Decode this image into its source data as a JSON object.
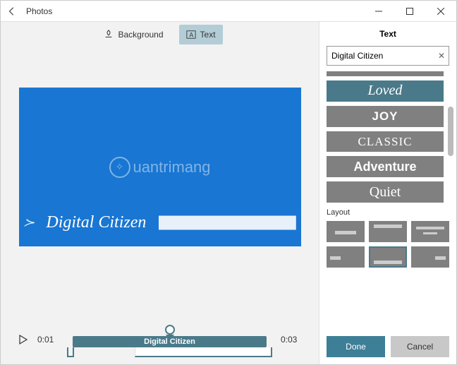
{
  "titlebar": {
    "app_name": "Photos"
  },
  "tabs": {
    "background": "Background",
    "text": "Text",
    "active": "text"
  },
  "preview": {
    "text": "Digital Citizen",
    "watermark": "uantrimang"
  },
  "timeline": {
    "start": "0:01",
    "end": "0:03",
    "clip_label": "Digital Citizen"
  },
  "panel": {
    "title": "Text",
    "input_value": "Digital Citizen",
    "styles": [
      {
        "label": "Loved",
        "class": "loved",
        "selected": true
      },
      {
        "label": "JOY",
        "class": "joy"
      },
      {
        "label": "CLASSIC",
        "class": "classic"
      },
      {
        "label": "Adventure",
        "class": "adventure"
      },
      {
        "label": "Quiet",
        "class": "quiet"
      }
    ],
    "layout_label": "Layout",
    "done": "Done",
    "cancel": "Cancel"
  }
}
